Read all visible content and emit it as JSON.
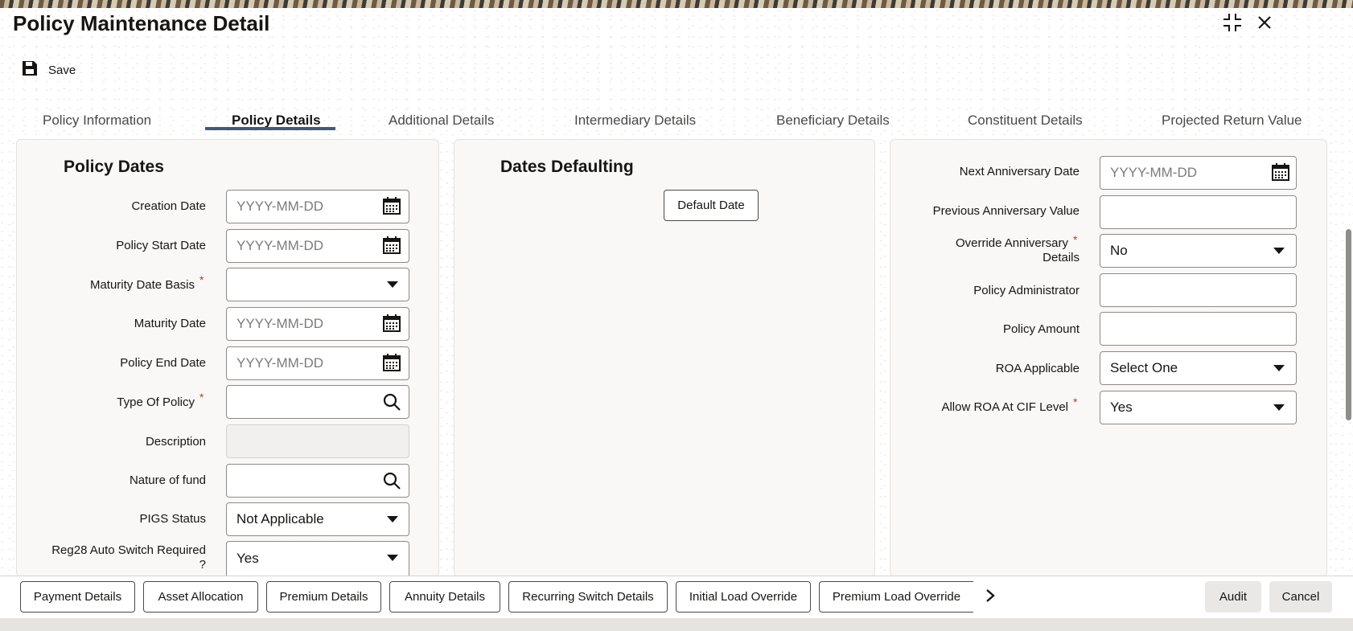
{
  "window": {
    "title": "Policy Maintenance Detail"
  },
  "toolbar": {
    "save_label": "Save"
  },
  "tabs": [
    {
      "label": "Policy Information"
    },
    {
      "label": "Policy Details",
      "active": true
    },
    {
      "label": "Additional Details"
    },
    {
      "label": "Intermediary Details"
    },
    {
      "label": "Beneficiary Details"
    },
    {
      "label": "Constituent Details"
    },
    {
      "label": "Projected Return Value"
    }
  ],
  "policy_dates": {
    "title": "Policy Dates",
    "creation_date": {
      "label": "Creation Date",
      "placeholder": "YYYY-MM-DD"
    },
    "policy_start_date": {
      "label": "Policy Start Date",
      "placeholder": "YYYY-MM-DD"
    },
    "maturity_date_basis": {
      "label": "Maturity Date Basis",
      "value": ""
    },
    "maturity_date": {
      "label": "Maturity Date",
      "placeholder": "YYYY-MM-DD"
    },
    "policy_end_date": {
      "label": "Policy End Date",
      "placeholder": "YYYY-MM-DD"
    },
    "type_of_policy": {
      "label": "Type Of Policy",
      "value": ""
    },
    "description": {
      "label": "Description",
      "value": ""
    },
    "nature_of_fund": {
      "label": "Nature of fund",
      "value": ""
    },
    "pigs_status": {
      "label": "PIGS Status",
      "value": "Not Applicable"
    },
    "reg28": {
      "label_line1": "Reg28 Auto Switch Required",
      "label_line2": "?",
      "value": "Yes"
    }
  },
  "dates_defaulting": {
    "title": "Dates Defaulting",
    "default_button": "Default Date"
  },
  "anniversary": {
    "next_anniversary_date": {
      "label": "Next Anniversary Date",
      "placeholder": "YYYY-MM-DD"
    },
    "previous_anniversary_value": {
      "label": "Previous Anniversary Value",
      "value": ""
    },
    "override_anniversary": {
      "label_line1": "Override Anniversary",
      "label_line2": "Details",
      "value": "No"
    },
    "policy_administrator": {
      "label": "Policy Administrator",
      "value": ""
    },
    "policy_amount": {
      "label": "Policy Amount",
      "value": ""
    },
    "roa_applicable": {
      "label": "ROA Applicable",
      "value": "Select One"
    },
    "allow_roa_cif": {
      "label": "Allow ROA At CIF Level",
      "value": "Yes"
    }
  },
  "required_marker": "*",
  "footer": {
    "buttons": [
      "Payment Details",
      "Asset Allocation",
      "Premium Details",
      "Annuity Details",
      "Recurring Switch Details",
      "Initial Load Override",
      "Premium Load Override"
    ],
    "audit": "Audit",
    "cancel": "Cancel"
  },
  "colors": {
    "tab_underline": "#3b5b80",
    "required": "#b83a2a"
  }
}
